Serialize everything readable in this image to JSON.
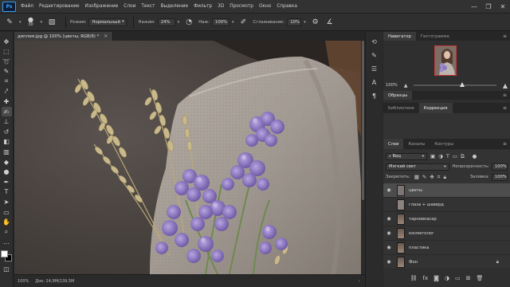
{
  "menu": {
    "logo": "Ps",
    "items": [
      "Файл",
      "Редактирование",
      "Изображение",
      "Слои",
      "Текст",
      "Выделение",
      "Фильтр",
      "3D",
      "Просмотр",
      "Окно",
      "Справка"
    ],
    "window_controls": [
      "—",
      "❐",
      "✕"
    ]
  },
  "options": {
    "brush_size": "30",
    "mode_label": "Режим:",
    "mode_value": "Нормальный",
    "pressure_label": "Нажим:",
    "pressure_value": "24%",
    "opacity_label": "Наж:",
    "opacity_value": "100%",
    "smoothing_label": "Сглаживание:",
    "smoothing_value": "10%"
  },
  "document": {
    "tab_title": "диплом.jpg @ 100% (цветы, RGB/8) *",
    "close": "×",
    "status_zoom": "100%",
    "status_info": "Док: 24,9M/139,5M"
  },
  "panels": {
    "navigator": {
      "tabs": [
        "Навигатор",
        "Гистограмма"
      ],
      "zoom": "100%"
    },
    "swatches": {
      "tabs": [
        "Образцы"
      ]
    },
    "libraries": {
      "tabs": [
        "Библиотеки",
        "Коррекция"
      ]
    },
    "layers": {
      "tabs": [
        "Слои",
        "Каналы",
        "Контуры"
      ],
      "filter_label": "Вид",
      "blend_mode": "Мягкий свет",
      "opacity_label": "Непрозрачность:",
      "opacity_value": "100%",
      "lock_label": "Закрепить:",
      "fill_label": "Заливка:",
      "fill_value": "100%",
      "items": [
        {
          "name": "цветы",
          "active": true
        },
        {
          "name": "глаза + шаверд",
          "active": false
        },
        {
          "name": "тарновкасар",
          "active": false
        },
        {
          "name": "косметолог",
          "active": false
        },
        {
          "name": "пластика",
          "active": false
        },
        {
          "name": "Фон",
          "active": false
        }
      ]
    }
  },
  "colors": {
    "foreground": "#ffffff",
    "background": "#000000",
    "accent": "#c63a3a"
  }
}
